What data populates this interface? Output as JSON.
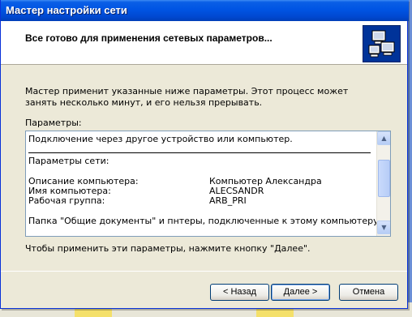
{
  "window": {
    "title": "Мастер настройки сети"
  },
  "header": {
    "heading": "Все готово для применения сетевых параметров...",
    "icon": "network-computers-icon"
  },
  "content": {
    "intro": "Мастер применит указанные ниже параметры. Этот процесс может занять несколько минут, и его нельзя прерывать.",
    "params_label": "Параметры:",
    "list": {
      "connection": "Подключение через другое устройство или компьютер.",
      "section_title": "Параметры сети:",
      "rows": [
        {
          "label": "Описание компьютера:",
          "value": "Компьютер Александра"
        },
        {
          "label": "Имя компьютера:",
          "value": "ALECSANDR"
        },
        {
          "label": "Рабочая группа:",
          "value": "ARB_PRI"
        }
      ],
      "shared": "Папка \"Общие документы\" и пнтеры, подключенные к этому компьютеру, будут"
    },
    "apply_note": "Чтобы применить эти параметры, нажмите кнопку \"Далее\"."
  },
  "buttons": {
    "back": "< Назад",
    "next": "Далее >",
    "cancel": "Отмена"
  }
}
